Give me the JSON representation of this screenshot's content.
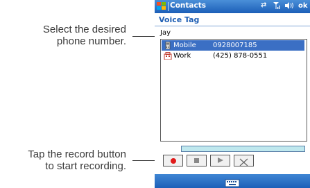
{
  "callouts": [
    {
      "line1": "Select the desired",
      "line2": "phone number."
    },
    {
      "line1": "Tap the record button",
      "line2": "to start recording."
    }
  ],
  "device": {
    "title_bar": {
      "app_title": "Contacts",
      "status_icons": [
        "sync-icon",
        "signal-icon",
        "speaker-icon"
      ],
      "ok_label": "ok"
    },
    "page_heading": "Voice Tag",
    "contact_name": "Jay",
    "phone_numbers": [
      {
        "label": "Mobile",
        "number": "0928007185",
        "selected": true,
        "icon": "mobile-phone-icon"
      },
      {
        "label": "Work",
        "number": "(425) 878-0551",
        "selected": false,
        "icon": "work-icon"
      }
    ],
    "controls": [
      "record-icon",
      "stop-icon",
      "play-icon",
      "delete-icon"
    ],
    "bottom_bar": {
      "icon": "keyboard-icon"
    }
  },
  "colors": {
    "title_bar": "#1c5fb8",
    "heading": "#1f5fb4",
    "selection": "#3b6fc4",
    "record": "#e11a1a",
    "progress_fill": "#bfe8ee"
  }
}
